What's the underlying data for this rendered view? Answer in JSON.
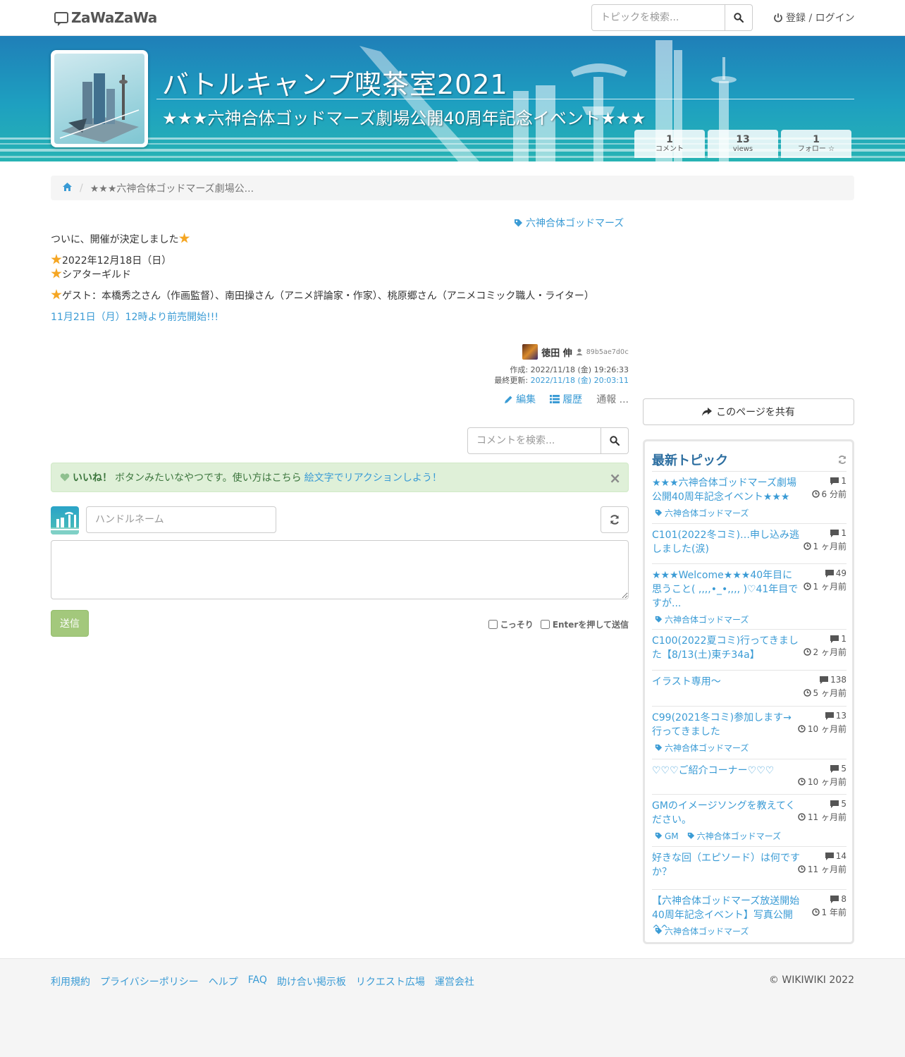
{
  "header": {
    "logo_text": "ZaWaZaWa",
    "search_placeholder": "トピックを検索...",
    "login_label": "登録 / ログイン"
  },
  "hero": {
    "title": "バトルキャンプ喫茶室2021",
    "subtitle": "★★★六神合体ゴッドマーズ劇場公開40周年記念イベント★★★",
    "stats": [
      {
        "value": "1",
        "label": "コメント"
      },
      {
        "value": "13",
        "label": "views"
      },
      {
        "value": "1",
        "label": "フォロー ☆"
      }
    ]
  },
  "breadcrumb": {
    "current": "★★★六神合体ゴッドマーズ劇場公..."
  },
  "article": {
    "tag": "六神合体ゴッドマーズ",
    "intro": "ついに、開催が決定しました",
    "date": "2022年12月18日（日）",
    "venue": "シアターギルド",
    "guests": "ゲスト：本橋秀之さん（作画監督）、南田操さん（アニメ評論家・作家）、桃原郷さん（アニメコミック職人・ライター）",
    "sale_link": "11月21日（月）12時より前売開始!!!",
    "author_name": "徳田 伸",
    "author_id": "89b5ae7dOc",
    "created_label": "作成: ",
    "created": "2022/11/18 (金) 19:26:33",
    "updated_label": "最終更新: ",
    "updated": "2022/11/18 (金) 20:03:11",
    "edit_label": "編集",
    "history_label": "履歴",
    "report_label": "通報 ..."
  },
  "comments": {
    "search_placeholder": "コメントを検索...",
    "alert_bold": "いいね！",
    "alert_text": "ボタンみたいなやつです。使い方はこちら",
    "alert_link": "絵文字でリアクションしよう！",
    "handle_placeholder": "ハンドルネーム",
    "send_label": "送信",
    "opt_secret": "こっそり",
    "opt_enter": "Enterを押して送信"
  },
  "sidebar": {
    "share_label": "このページを共有",
    "latest_title": "最新トピック",
    "topics": [
      {
        "title": "★★★六神合体ゴッドマーズ劇場公開40周年記念イベント★★★",
        "count": "1",
        "time": "6 分前",
        "tags": [
          "六神合体ゴッドマーズ"
        ]
      },
      {
        "title": "C101(2022冬コミ)…申し込み逃しました(涙)",
        "count": "1",
        "time": "1 ヶ月前",
        "tags": []
      },
      {
        "title": "★★★Welcome★★★40年目に思うこと( ,,,,•_•,,,, )♡41年目ですが...",
        "count": "49",
        "time": "1 ヶ月前",
        "tags": [
          "六神合体ゴッドマーズ"
        ]
      },
      {
        "title": "C100(2022夏コミ)行ってきました【8/13(土)東チ34a】",
        "count": "1",
        "time": "2 ヶ月前",
        "tags": []
      },
      {
        "title": "イラスト専用～",
        "count": "138",
        "time": "5 ヶ月前",
        "tags": []
      },
      {
        "title": "C99(2021冬コミ)参加します→行ってきました",
        "count": "13",
        "time": "10 ヶ月前",
        "tags": [
          "六神合体ゴッドマーズ"
        ]
      },
      {
        "title": "♡♡♡ご紹介コーナー♡♡♡",
        "count": "5",
        "time": "10 ヶ月前",
        "tags": []
      },
      {
        "title": "GMのイメージソングを教えてください。",
        "count": "5",
        "time": "11 ヶ月前",
        "tags": [
          "GM",
          "六神合体ゴッドマーズ"
        ]
      },
      {
        "title": "好きな回（エピソード）は何ですか？",
        "count": "14",
        "time": "11 ヶ月前",
        "tags": []
      },
      {
        "title": "【六神合体ゴッドマーズ放送開始40周年記念イベント】写真公開^^",
        "count": "8",
        "time": "1 年前",
        "tags": [
          "六神合体ゴッドマーズ"
        ]
      }
    ]
  },
  "footer": {
    "links": [
      "利用規約",
      "プライバシーポリシー",
      "ヘルプ",
      "FAQ",
      "助け合い掲示板",
      "リクエスト広場",
      "運営会社"
    ],
    "copyright": "© WIKIWIKI 2022"
  },
  "colors": {
    "link": "#3a9bd5",
    "hero_top": "#1f7fb8",
    "hero_bottom": "#27b3b4",
    "alert_bg": "#dff0d8",
    "send_button": "#a3c87c",
    "panel_title": "#2c6ea0"
  }
}
